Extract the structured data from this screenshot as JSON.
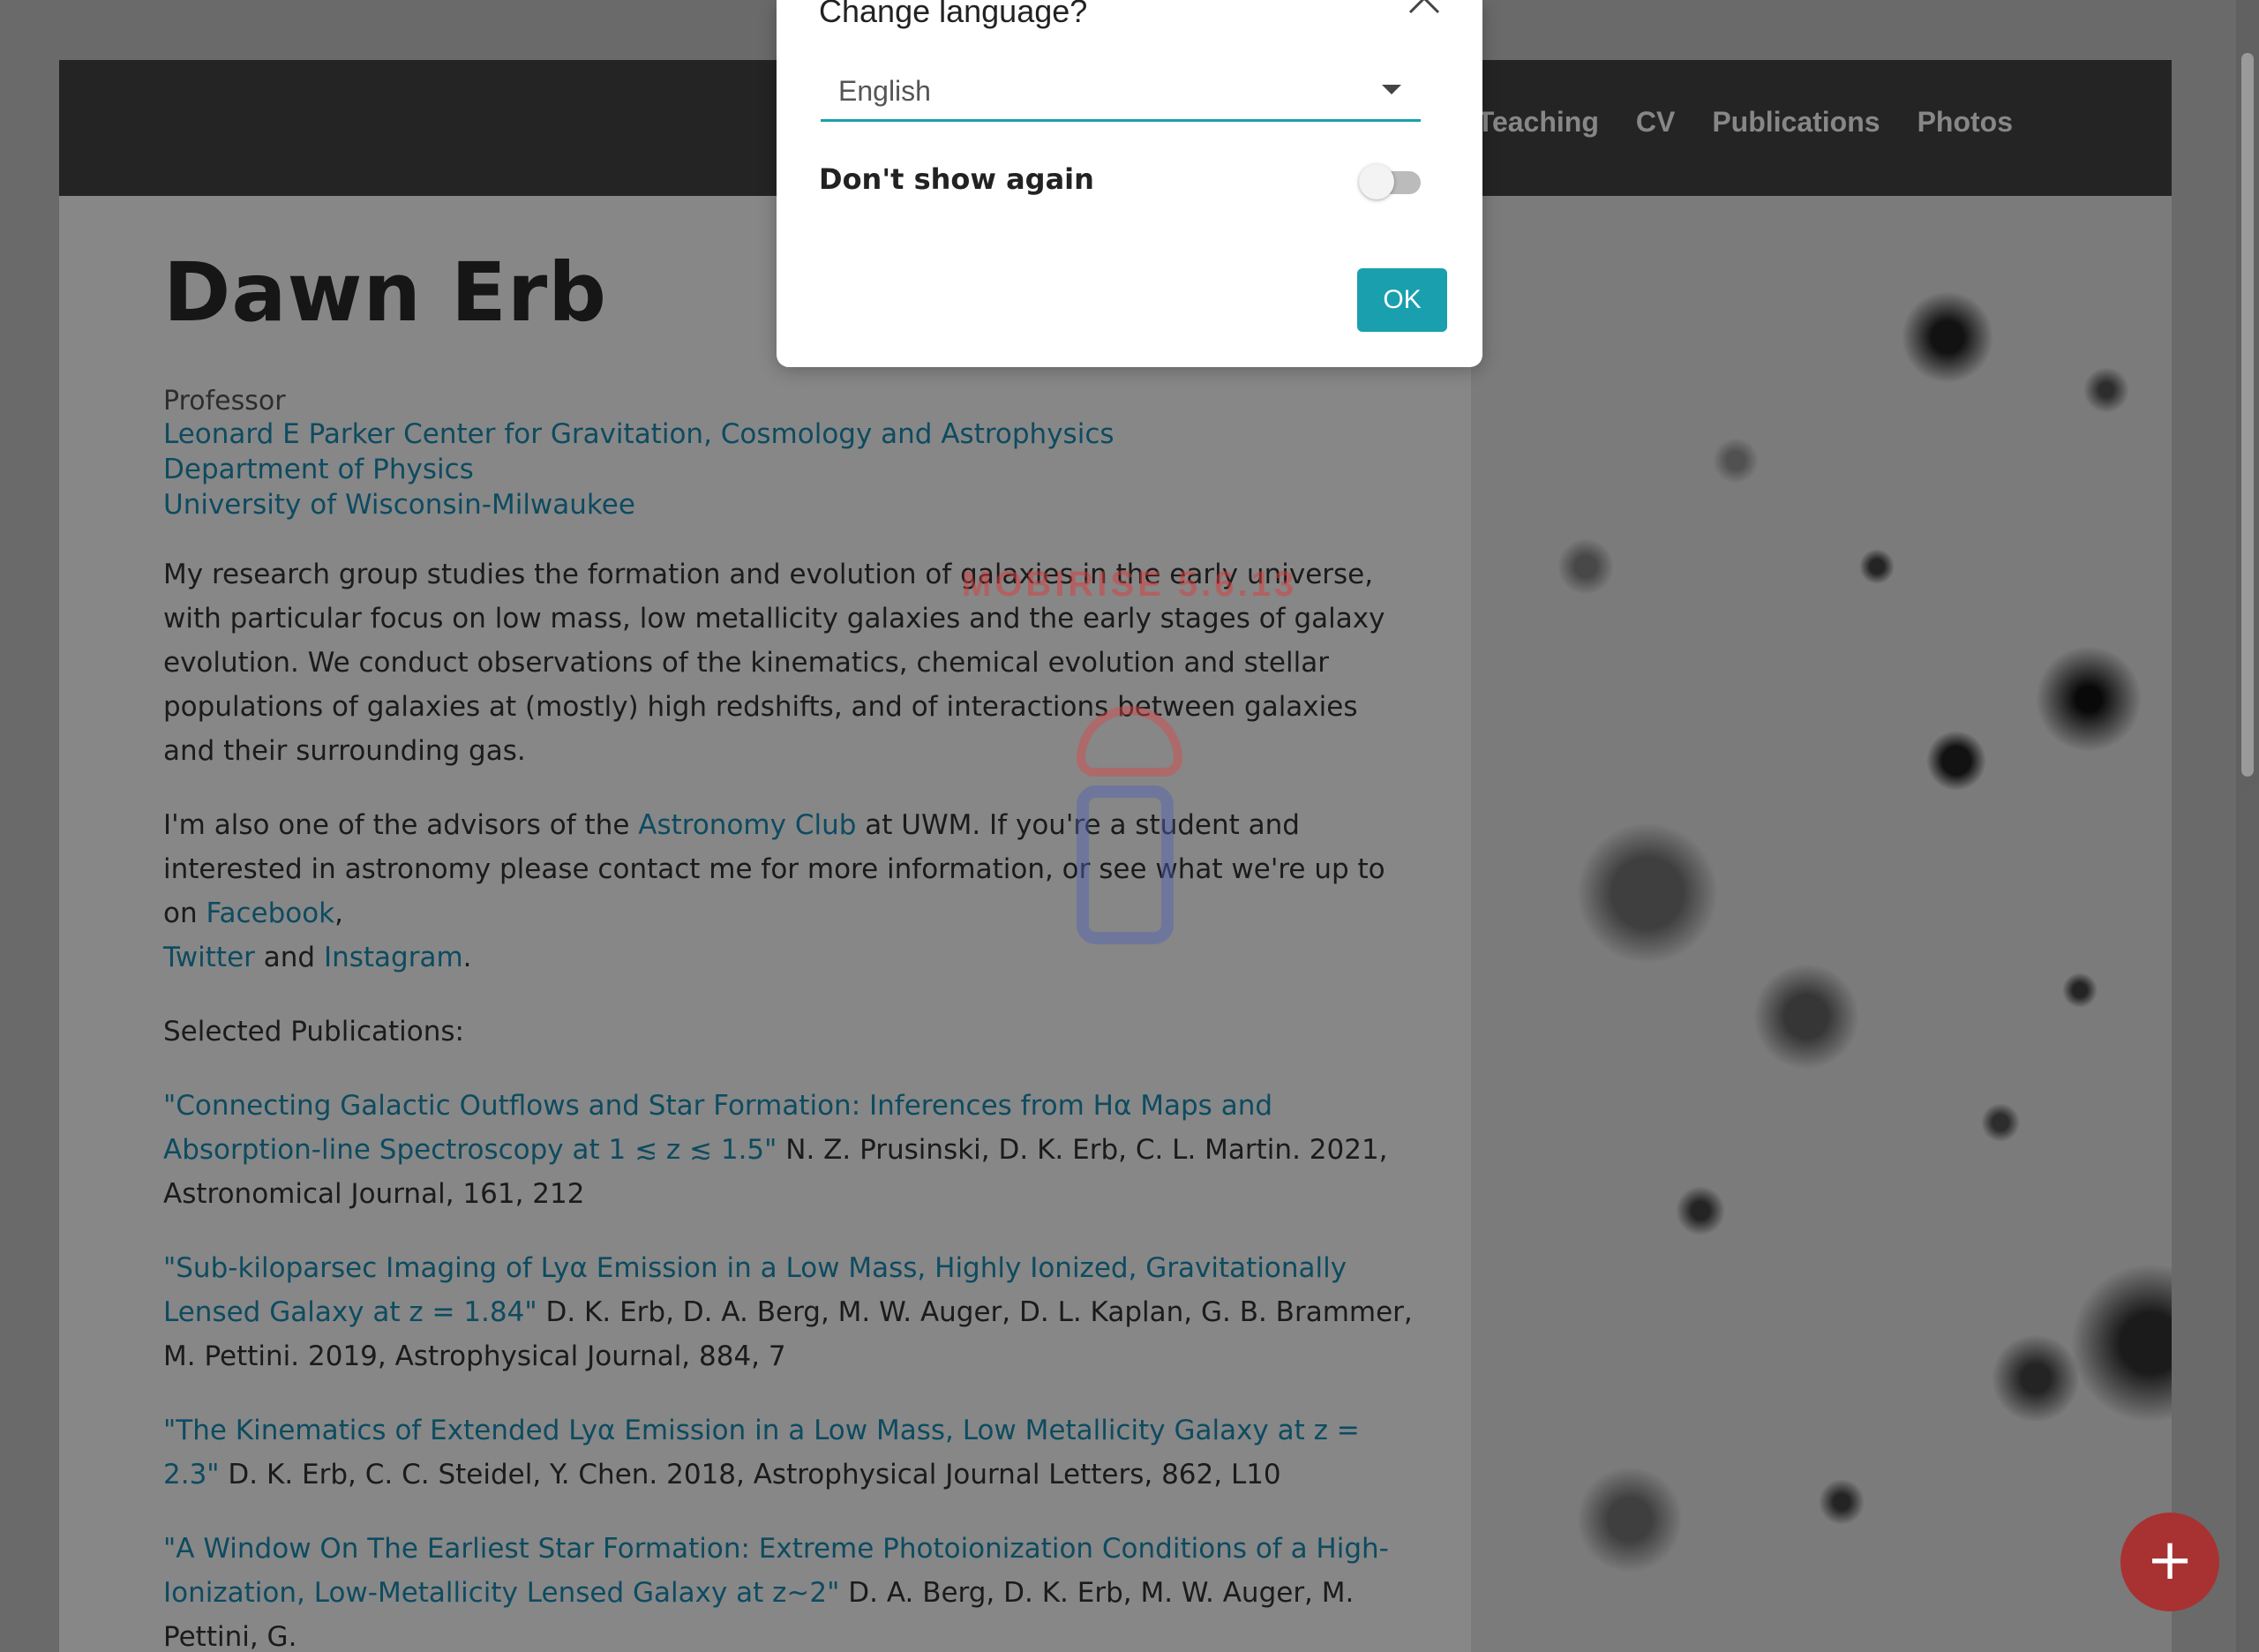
{
  "nav": {
    "items": [
      "Teaching",
      "CV",
      "Publications",
      "Photos"
    ]
  },
  "profile": {
    "name": "Dawn Erb",
    "role": "Professor",
    "affiliations": [
      "Leonard E Parker Center for Gravitation, Cosmology and Astrophysics",
      "Department of Physics",
      "University of Wisconsin-Milwaukee"
    ]
  },
  "bio": {
    "research": "My research group studies the formation and evolution of galaxies in the early universe, with particular focus on low mass, low metallicity galaxies and the early stages of galaxy evolution. We conduct observations of the kinematics, chemical evolution and stellar populations of galaxies at (mostly) high redshifts, and of interactions between galaxies and their surrounding gas.",
    "club_prefix": "I'm also one of the advisors of the ",
    "club_link": "Astronomy Club",
    "club_mid": " at UWM. If you're a student and interested in astronomy please contact me for more information, or see what we're up to on ",
    "facebook": "Facebook",
    "comma": ",",
    "twitter": "Twitter",
    "and": " and ",
    "instagram": "Instagram",
    "period": "."
  },
  "publications": {
    "heading": "Selected Publications:",
    "items": [
      {
        "title": "\"Connecting Galactic Outflows and Star Formation: Inferences from Hα Maps and Absorption-line Spectroscopy at 1 ≲ z ≲ 1.5\"",
        "citation": " N. Z. Prusinski, D. K. Erb, C. L. Martin. 2021, Astronomical Journal, 161, 212"
      },
      {
        "title": "\"Sub-kiloparsec Imaging of Lyα Emission in a Low Mass, Highly Ionized, Gravitationally Lensed Galaxy at z = 1.84\"",
        "citation": " D. K. Erb, D. A. Berg, M. W. Auger, D. L. Kaplan, G. B. Brammer, M. Pettini. 2019, Astrophysical Journal, 884, 7"
      },
      {
        "title": "\"The Kinematics of Extended Lyα Emission in a Low Mass, Low Metallicity Galaxy at z = 2.3\"",
        "citation": " D. K. Erb, C. C. Steidel, Y. Chen. 2018, Astrophysical Journal Letters, 862, L10"
      },
      {
        "title": "\"A Window On The Earliest Star Formation: Extreme Photoionization Conditions of a High-Ionization, Low-Metallicity Lensed Galaxy at z~2\"",
        "citation": " D. A. Berg, D. K. Erb, M. W. Auger, M. Pettini, G."
      }
    ]
  },
  "watermark": "MOBIRISE 5.6.13",
  "modal": {
    "title": "Change language?",
    "language_value": "English",
    "dont_show_label": "Don't show again",
    "ok_label": "OK"
  },
  "fab": {
    "label": "+"
  },
  "colors": {
    "link": "#1a8fb5",
    "navbar": "#444444",
    "accent": "#1a9fae",
    "fab": "#a83232"
  }
}
